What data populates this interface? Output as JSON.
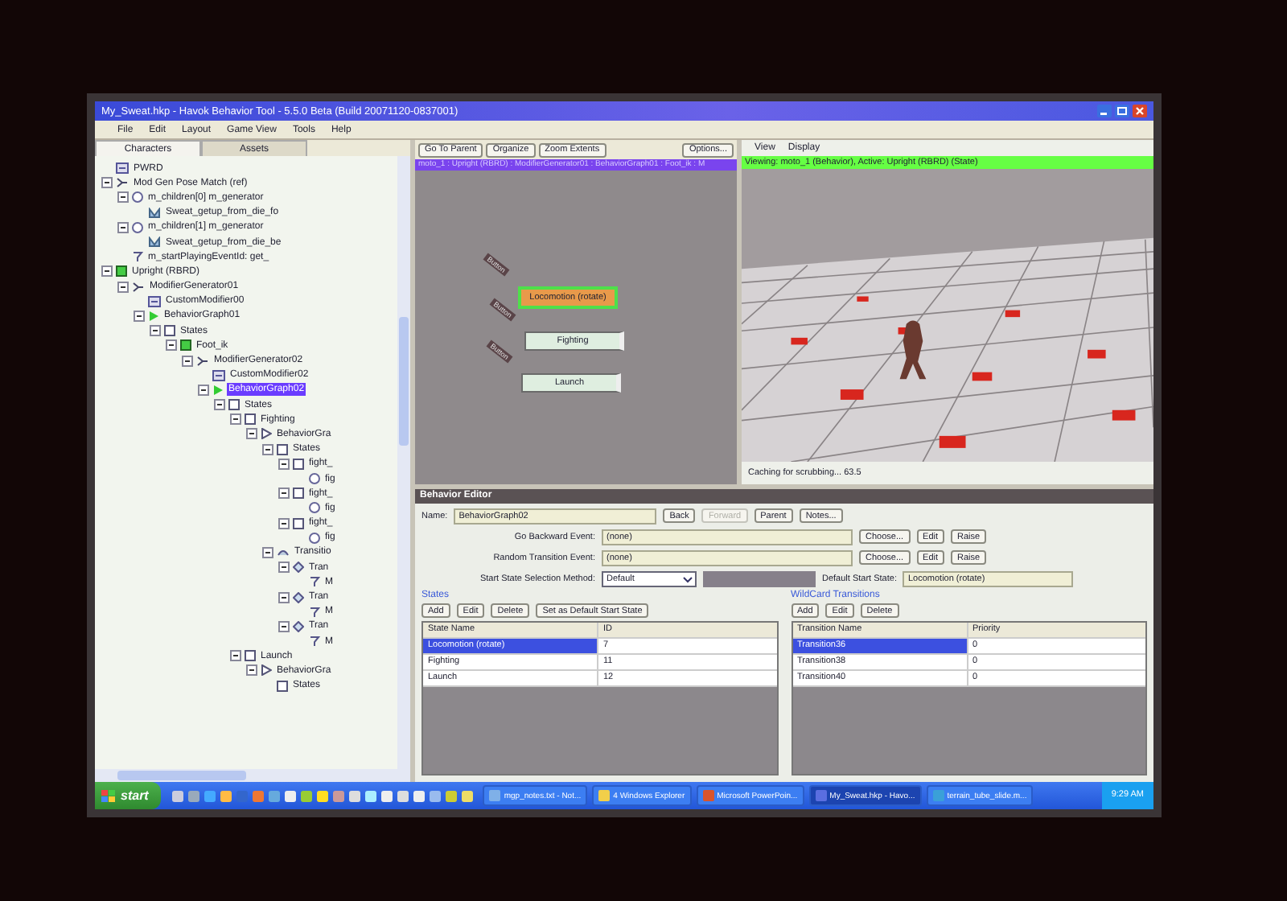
{
  "window": {
    "title": "My_Sweat.hkp - Havok Behavior Tool - 5.5.0 Beta (Build 20071120-0837001)"
  },
  "menu": [
    "File",
    "Edit",
    "Layout",
    "Game View",
    "Tools",
    "Help"
  ],
  "left_tabs": [
    {
      "label": "Characters",
      "selected": true
    },
    {
      "label": "Assets",
      "selected": false
    }
  ],
  "tree": [
    {
      "label": "PWRD",
      "kind": "module",
      "selected": false
    },
    {
      "label": "Mod Gen Pose Match (ref)",
      "kind": "generator",
      "selected": false,
      "children": [
        {
          "label": "m_children[0] m_generator",
          "kind": "circle",
          "selected": false,
          "children": [
            {
              "label": "Sweat_getup_from_die_fo",
              "kind": "anim",
              "selected": false
            }
          ]
        },
        {
          "label": "m_children[1] m_generator",
          "kind": "circle",
          "selected": false,
          "children": [
            {
              "label": "Sweat_getup_from_die_be",
              "kind": "anim",
              "selected": false
            }
          ]
        },
        {
          "label": "m_startPlayingEventId: get_",
          "kind": "event",
          "selected": false
        }
      ]
    },
    {
      "label": "Upright (RBRD)",
      "kind": "state-active",
      "selected": false,
      "children": [
        {
          "label": "ModifierGenerator01",
          "kind": "generator",
          "selected": false,
          "children": [
            {
              "label": "CustomModifier00",
              "kind": "module",
              "selected": false
            },
            {
              "label": "BehaviorGraph01",
              "kind": "graph-active",
              "selected": false,
              "children": [
                {
                  "label": "States",
                  "kind": "state",
                  "selected": false,
                  "children": [
                    {
                      "label": "Foot_ik",
                      "kind": "state-active",
                      "selected": false,
                      "children": [
                        {
                          "label": "ModifierGenerator02",
                          "kind": "generator",
                          "selected": false,
                          "children": [
                            {
                              "label": "CustomModifier02",
                              "kind": "module",
                              "selected": false
                            },
                            {
                              "label": "BehaviorGraph02",
                              "kind": "graph-active",
                              "selected": true,
                              "children": [
                                {
                                  "label": "States",
                                  "kind": "state",
                                  "selected": false,
                                  "children": [
                                    {
                                      "label": "Fighting",
                                      "kind": "state",
                                      "selected": false,
                                      "children": [
                                        {
                                          "label": "BehaviorGra",
                                          "kind": "graph",
                                          "selected": false,
                                          "children": [
                                            {
                                              "label": "States",
                                              "kind": "state",
                                              "selected": false,
                                              "children": [
                                                {
                                                  "label": "fight_",
                                                  "kind": "state",
                                                  "selected": false,
                                                  "children": [
                                                    {
                                                      "label": "fig",
                                                      "kind": "circle",
                                                      "selected": false
                                                    }
                                                  ]
                                                },
                                                {
                                                  "label": "fight_",
                                                  "kind": "state",
                                                  "selected": false,
                                                  "children": [
                                                    {
                                                      "label": "fig",
                                                      "kind": "circle",
                                                      "selected": false
                                                    }
                                                  ]
                                                },
                                                {
                                                  "label": "fight_",
                                                  "kind": "state",
                                                  "selected": false,
                                                  "children": [
                                                    {
                                                      "label": "fig",
                                                      "kind": "circle",
                                                      "selected": false
                                                    }
                                                  ]
                                                }
                                              ]
                                            },
                                            {
                                              "label": "Transitio",
                                              "kind": "transitions",
                                              "selected": false,
                                              "children": [
                                                {
                                                  "label": "Tran",
                                                  "kind": "transition",
                                                  "selected": false,
                                                  "children": [
                                                    {
                                                      "label": "M",
                                                      "kind": "event",
                                                      "selected": false
                                                    }
                                                  ]
                                                },
                                                {
                                                  "label": "Tran",
                                                  "kind": "transition",
                                                  "selected": false,
                                                  "children": [
                                                    {
                                                      "label": "M",
                                                      "kind": "event",
                                                      "selected": false
                                                    }
                                                  ]
                                                },
                                                {
                                                  "label": "Tran",
                                                  "kind": "transition",
                                                  "selected": false,
                                                  "children": [
                                                    {
                                                      "label": "M",
                                                      "kind": "event",
                                                      "selected": false
                                                    }
                                                  ]
                                                }
                                              ]
                                            }
                                          ]
                                        }
                                      ]
                                    },
                                    {
                                      "label": "Launch",
                                      "kind": "state",
                                      "selected": false,
                                      "children": [
                                        {
                                          "label": "BehaviorGra",
                                          "kind": "graph",
                                          "selected": false,
                                          "children": [
                                            {
                                              "label": "States",
                                              "kind": "state",
                                              "selected": false
                                            }
                                          ]
                                        }
                                      ]
                                    }
                                  ]
                                }
                              ]
                            }
                          ]
                        }
                      ]
                    }
                  ]
                }
              ]
            }
          ]
        }
      ]
    }
  ],
  "graph_toolbar": [
    "Go To Parent",
    "Organize",
    "Zoom Extents"
  ],
  "graph_options": "Options...",
  "breadcrumb": "moto_1 : Upright (RBRD) : ModifierGenerator01 : BehaviorGraph01 : Foot_ik : M",
  "graph_nodes": [
    {
      "label": "Locomotion (rotate)",
      "tag": "Button",
      "selected": true
    },
    {
      "label": "Fighting",
      "tag": "Button",
      "selected": false
    },
    {
      "label": "Launch",
      "tag": "Button",
      "selected": false
    }
  ],
  "viewport": {
    "menu": [
      "View",
      "Display"
    ],
    "status": "Viewing: moto_1 (Behavior), Active: Upright (RBRD) (State)",
    "caption": "Caching for scrubbing... 63.5"
  },
  "editor": {
    "title": "Behavior Editor",
    "name_label": "Name:",
    "name": "BehaviorGraph02",
    "nav_buttons": [
      {
        "label": "Back",
        "disabled": false
      },
      {
        "label": "Forward",
        "disabled": true
      },
      {
        "label": "Parent",
        "disabled": false
      },
      {
        "label": "Notes...",
        "disabled": false
      }
    ],
    "events": [
      {
        "label": "Go Backward Event:",
        "value": "(none)",
        "buttons": [
          "Choose...",
          "Edit",
          "Raise"
        ]
      },
      {
        "label": "Random Transition Event:",
        "value": "(none)",
        "buttons": [
          "Choose...",
          "Edit",
          "Raise"
        ]
      }
    ],
    "method_label": "Start State Selection Method:",
    "method": "Default",
    "default_label": "Default Start State:",
    "default_state": "Locomotion (rotate)",
    "states": {
      "title": "States",
      "buttons": [
        "Add",
        "Edit",
        "Delete",
        "Set as Default Start State"
      ],
      "columns": [
        "State Name",
        "ID"
      ],
      "rows": [
        {
          "cells": [
            "Locomotion (rotate)",
            "7"
          ],
          "selected": true
        },
        {
          "cells": [
            "Fighting",
            "11"
          ],
          "selected": false
        },
        {
          "cells": [
            "Launch",
            "12"
          ],
          "selected": false
        }
      ]
    },
    "wildcards": {
      "title": "WildCard Transitions",
      "buttons": [
        "Add",
        "Edit",
        "Delete"
      ],
      "columns": [
        "Transition Name",
        "Priority"
      ],
      "rows": [
        {
          "cells": [
            "Transition36",
            "0"
          ],
          "selected": true
        },
        {
          "cells": [
            "Transition38",
            "0"
          ],
          "selected": false
        },
        {
          "cells": [
            "Transition40",
            "0"
          ],
          "selected": false
        }
      ]
    }
  },
  "taskbar": {
    "start": "start",
    "tasks": [
      {
        "label": "mgp_notes.txt - Not...",
        "kind": "notepad",
        "active": false
      },
      {
        "label": "4 Windows Explorer",
        "kind": "folder",
        "active": false
      },
      {
        "label": "Microsoft PowerPoin...",
        "kind": "slides",
        "active": false
      },
      {
        "label": "My_Sweat.hkp - Havo...",
        "kind": "app",
        "active": true
      },
      {
        "label": "terrain_tube_slide.m...",
        "kind": "globe",
        "active": false
      }
    ],
    "clock": "9:29 AM"
  }
}
